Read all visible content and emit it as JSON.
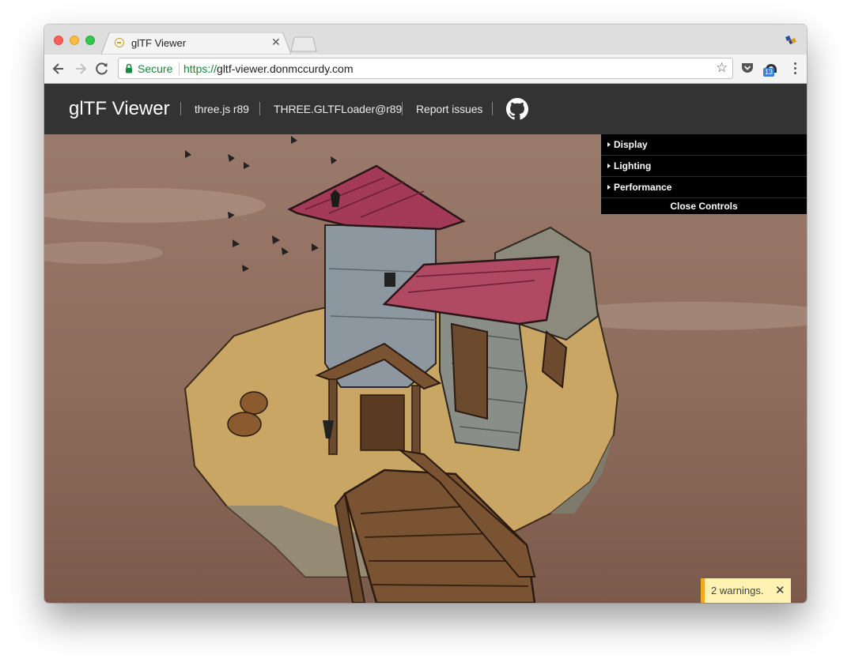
{
  "browser": {
    "tab_title": "glTF Viewer",
    "tab_close": "✕",
    "secure_label": "Secure",
    "url_scheme": "https://",
    "url_host": "gltf-viewer.donmccurdy.com",
    "extension_badge": "13"
  },
  "header": {
    "brand": "glTF Viewer",
    "links": [
      "three.js r89",
      "THREE.GLTFLoader@r89",
      "Report issues"
    ]
  },
  "controls": {
    "folders": [
      "Display",
      "Lighting",
      "Performance"
    ],
    "close_label": "Close Controls"
  },
  "toast": {
    "message": "2 warnings.",
    "close": "✕"
  },
  "colors": {
    "header_bg": "#333333",
    "secure_green": "#168a3c",
    "toast_bg": "#fff2b3",
    "toast_accent": "#f6a623",
    "scene_bg": "#8e6c5c"
  }
}
